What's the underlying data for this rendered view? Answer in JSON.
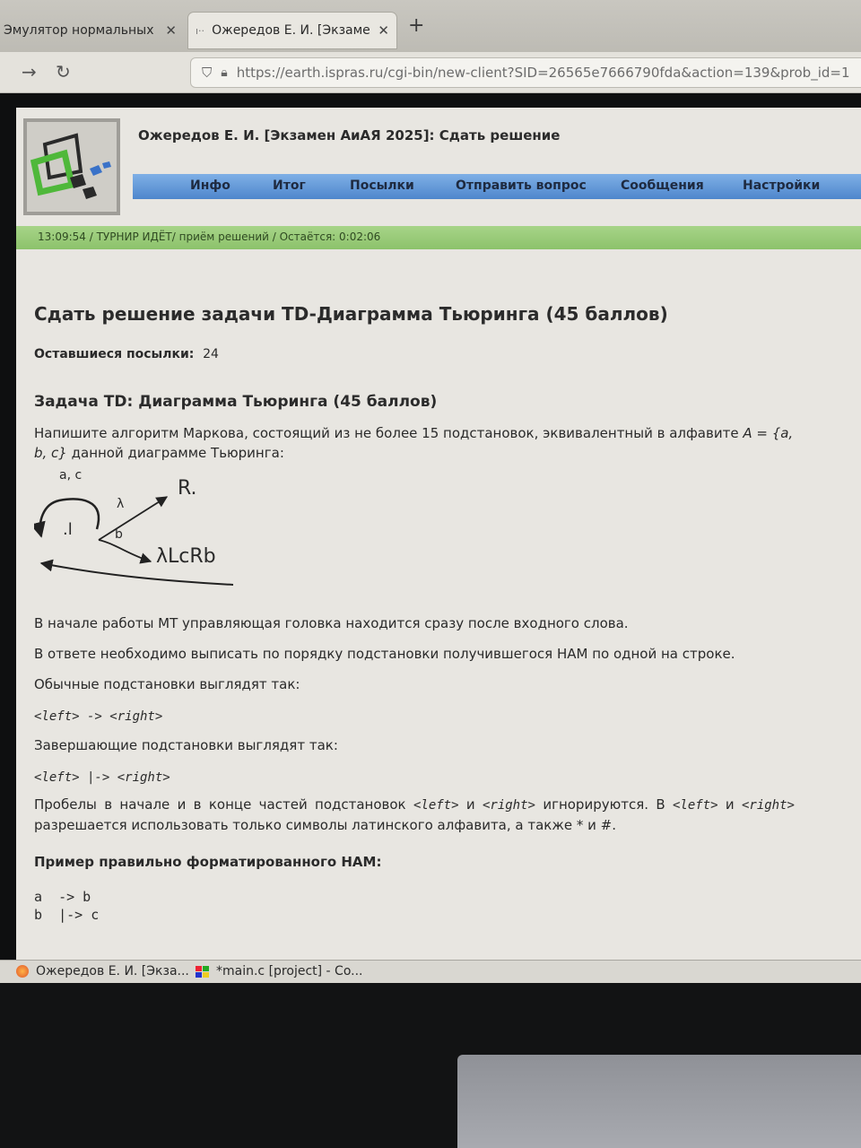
{
  "browser": {
    "tabs": [
      {
        "label": "Эмулятор нормальных а",
        "active": false
      },
      {
        "label": "Ожередов Е. И. [Экзаме",
        "active": true
      }
    ],
    "new_tab": "+",
    "url": "https://earth.ispras.ru/cgi-bin/new-client?SID=26565e7666790fda&action=139&prob_id=1"
  },
  "header": {
    "title": "Ожередов Е. И. [Экзамен АиАЯ 2025]: Сдать решение"
  },
  "menu": [
    "Инфо",
    "Итог",
    "Посылки",
    "Отправить вопрос",
    "Сообщения",
    "Настройки"
  ],
  "status_bar": "13:09:54 / ТУРНИР ИДЁТ/ приём решений / Остаётся: 0:02:06",
  "main": {
    "heading": "Сдать решение задачи TD-Диаграмма Тьюринга (45 баллов)",
    "remaining_label": "Оставшиеся посылки:",
    "remaining_value": "24",
    "problem_heading": "Задача TD: Диаграмма Тьюринга (45 баллов)",
    "intro_1": "Напишите алгоритм Маркова, состоящий из не более 15 подстановок, эквивалентный в алфавите ",
    "intro_alphabet": "A = {a, b, c}",
    "intro_2": " данной диаграмме Тьюринга:",
    "diagram": {
      "loop_label": "a, c",
      "start_node": ".l",
      "lambda_label": "λ",
      "b_label": "b",
      "target_r": "R.",
      "target_seq": "λLcRb"
    },
    "para_head": "В начале работы МТ управляющая головка находится сразу после входного слова.",
    "para_answer": "В ответе необходимо выписать по порядку подстановки получившегося НАМ по одной на строке.",
    "para_normal": "Обычные подстановки выглядят так:",
    "normal_example": "<left>  ->  <right>",
    "para_final": "Завершающие подстановки выглядят так:",
    "final_example": "<left>  |->  <right>",
    "para_spaces_1": "Пробелы в начале и в конце частей подстановок ",
    "para_spaces_left": "<left>",
    "para_spaces_and": " и ",
    "para_spaces_right": "<right>",
    "para_spaces_2": " игнорируются. В ",
    "para_spaces_left2": "<left>",
    "para_spaces_and2": " и ",
    "para_spaces_right2": "<right>",
    "para_spaces_3": " разрешается использовать только символы латинского алфавита, а также * и #.",
    "example_heading": "Пример правильно форматированного НАМ:",
    "example_lines": [
      "a  -> b",
      "b  |-> c"
    ]
  },
  "taskbar": [
    {
      "label": "Ожередов Е. И. [Экза..."
    },
    {
      "label": "*main.c [project] - Co..."
    }
  ],
  "colors": {
    "menu_blue": "#5a90d2",
    "status_green": "#9bcd7a",
    "page_bg": "#e8e6e1"
  }
}
